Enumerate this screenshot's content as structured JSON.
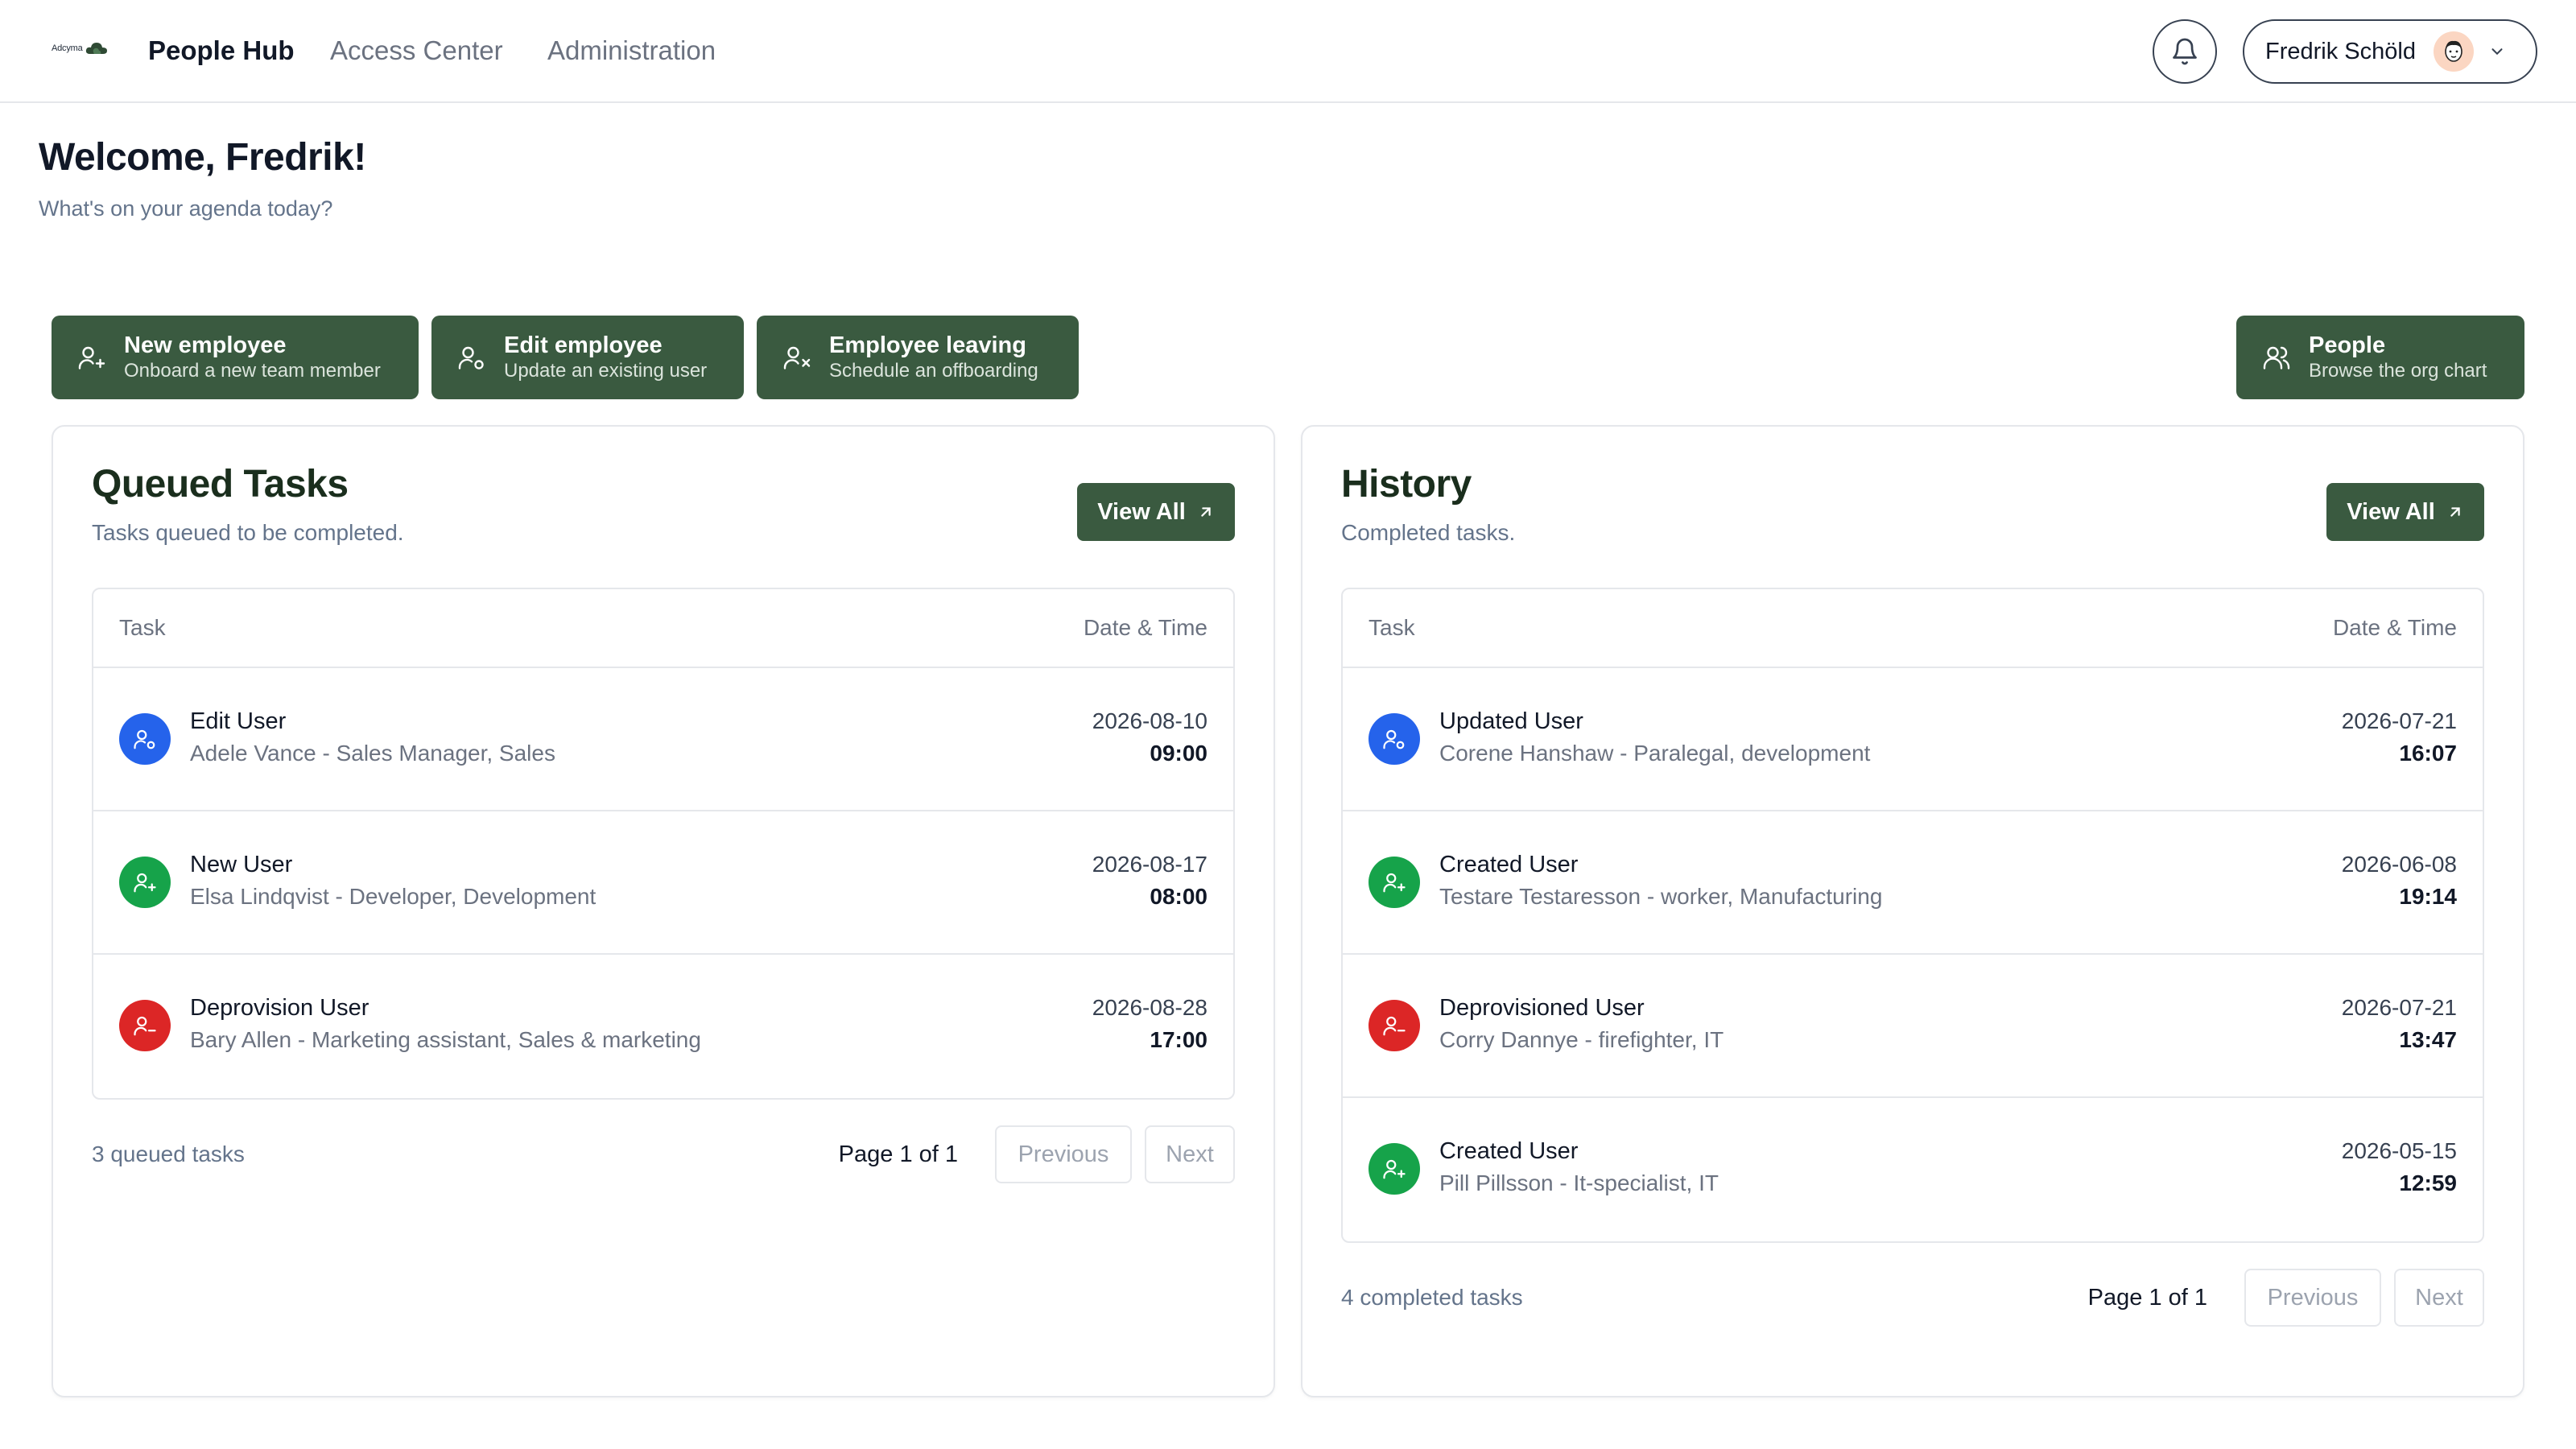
{
  "header": {
    "logo_text": "Adcyma",
    "brand": "People Hub",
    "nav": [
      "Access Center",
      "Administration"
    ],
    "user_name": "Fredrik Schöld"
  },
  "welcome": {
    "title": "Welcome, Fredrik!",
    "subtitle": "What's on your agenda today?"
  },
  "actions": [
    {
      "title": "New employee",
      "subtitle": "Onboard a new team member",
      "icon": "user-plus-icon"
    },
    {
      "title": "Edit employee",
      "subtitle": "Update an existing user",
      "icon": "user-edit-icon"
    },
    {
      "title": "Employee leaving",
      "subtitle": "Schedule an offboarding",
      "icon": "user-x-icon"
    },
    {
      "title": "People",
      "subtitle": "Browse the org chart",
      "icon": "users-icon"
    }
  ],
  "queued": {
    "title": "Queued Tasks",
    "subtitle": "Tasks queued to be completed.",
    "view_all": "View All",
    "col_task": "Task",
    "col_date": "Date & Time",
    "rows": [
      {
        "title": "Edit User",
        "detail": "Adele Vance - Sales Manager, Sales",
        "date": "2026-08-10",
        "time": "09:00",
        "color": "#2563eb",
        "icon": "user-edit-icon"
      },
      {
        "title": "New User",
        "detail": "Elsa Lindqvist - Developer, Development",
        "date": "2026-08-17",
        "time": "08:00",
        "color": "#16a34a",
        "icon": "user-plus-icon"
      },
      {
        "title": "Deprovision User",
        "detail": "Bary Allen - Marketing assistant, Sales & marketing",
        "date": "2026-08-28",
        "time": "17:00",
        "color": "#dc2626",
        "icon": "user-minus-icon"
      }
    ],
    "count": "3 queued tasks",
    "page": "Page 1 of 1",
    "prev": "Previous",
    "next": "Next"
  },
  "history": {
    "title": "History",
    "subtitle": "Completed tasks.",
    "view_all": "View All",
    "col_task": "Task",
    "col_date": "Date & Time",
    "rows": [
      {
        "title": "Updated User",
        "detail": "Corene Hanshaw - Paralegal, development",
        "date": "2026-07-21",
        "time": "16:07",
        "color": "#2563eb",
        "icon": "user-edit-icon"
      },
      {
        "title": "Created User",
        "detail": "Testare Testaresson - worker, Manufacturing",
        "date": "2026-06-08",
        "time": "19:14",
        "color": "#16a34a",
        "icon": "user-plus-icon"
      },
      {
        "title": "Deprovisioned User",
        "detail": "Corry Dannye - firefighter, IT",
        "date": "2026-07-21",
        "time": "13:47",
        "color": "#dc2626",
        "icon": "user-minus-icon"
      },
      {
        "title": "Created User",
        "detail": "Pill Pillsson - It-specialist, IT",
        "date": "2026-05-15",
        "time": "12:59",
        "color": "#16a34a",
        "icon": "user-plus-icon"
      }
    ],
    "count": "4 completed tasks",
    "page": "Page 1 of 1",
    "prev": "Previous",
    "next": "Next"
  }
}
